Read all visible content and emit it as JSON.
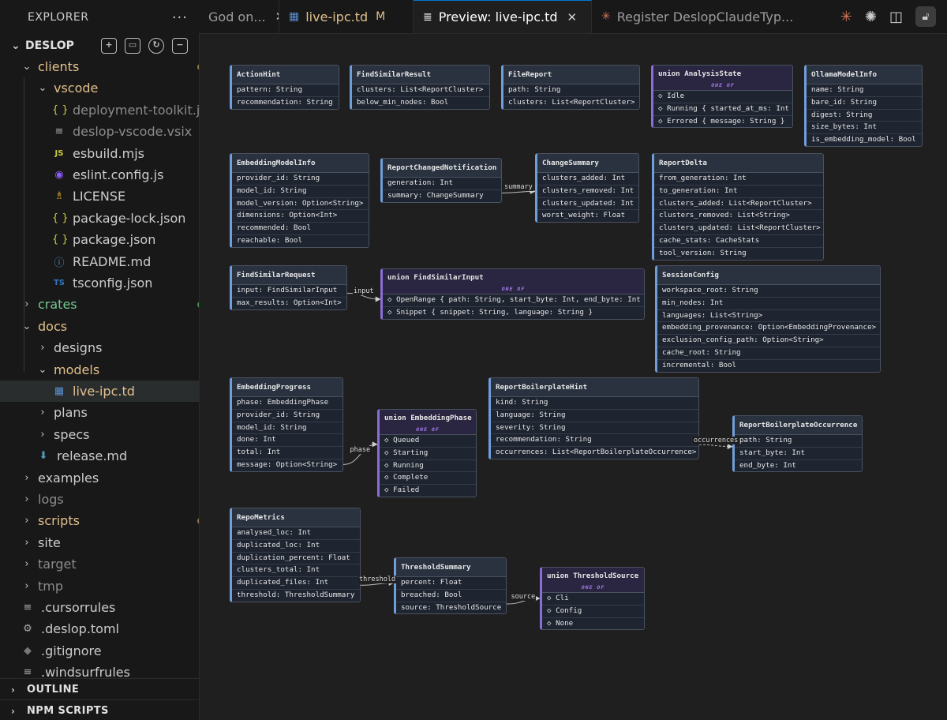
{
  "explorer": {
    "title": "EXPLORER",
    "project": "DESLOP",
    "tree": [
      {
        "label": "clients",
        "kind": "folder",
        "open": true,
        "depth": 0,
        "color": "yellow",
        "status": "dot"
      },
      {
        "label": "vscode",
        "kind": "folder",
        "open": true,
        "depth": 1,
        "color": "yellow",
        "status": "dot"
      },
      {
        "label": "deployment-toolkit.j...",
        "kind": "file",
        "icon": "{ }",
        "depth": 2,
        "color": "gray"
      },
      {
        "label": "deslop-vscode.vsix",
        "kind": "file",
        "icon": "≡",
        "depth": 2,
        "color": "gray"
      },
      {
        "label": "esbuild.mjs",
        "kind": "file",
        "icon": "JS",
        "depth": 2
      },
      {
        "label": "eslint.config.js",
        "kind": "file",
        "icon": "◉",
        "depth": 2
      },
      {
        "label": "LICENSE",
        "kind": "file",
        "icon": "♗",
        "depth": 2,
        "status": "arrow"
      },
      {
        "label": "package-lock.json",
        "kind": "file",
        "icon": "{ }",
        "depth": 2
      },
      {
        "label": "package.json",
        "kind": "file",
        "icon": "{ }",
        "depth": 2
      },
      {
        "label": "README.md",
        "kind": "file",
        "icon": "ⓘ",
        "depth": 2
      },
      {
        "label": "tsconfig.json",
        "kind": "file",
        "icon": "TS",
        "depth": 2
      },
      {
        "label": "crates",
        "kind": "folder",
        "open": false,
        "depth": 0,
        "color": "green",
        "status": "dot-green"
      },
      {
        "label": "docs",
        "kind": "folder",
        "open": true,
        "depth": 0,
        "color": "yellow"
      },
      {
        "label": "designs",
        "kind": "folder",
        "open": false,
        "depth": 1
      },
      {
        "label": "models",
        "kind": "folder",
        "open": true,
        "depth": 1,
        "color": "yellow",
        "status": "dot"
      },
      {
        "label": "live-ipc.td",
        "kind": "file",
        "icon": "▦",
        "depth": 2,
        "color": "yellow",
        "status": "M",
        "selected": true
      },
      {
        "label": "plans",
        "kind": "folder",
        "open": false,
        "depth": 1,
        "status": "dot"
      },
      {
        "label": "specs",
        "kind": "folder",
        "open": false,
        "depth": 1
      },
      {
        "label": "release.md",
        "kind": "file",
        "icon": "⬇",
        "depth": 1
      },
      {
        "label": "examples",
        "kind": "folder",
        "open": false,
        "depth": 0
      },
      {
        "label": "logs",
        "kind": "folder",
        "open": false,
        "depth": 0,
        "color": "gray"
      },
      {
        "label": "scripts",
        "kind": "folder",
        "open": false,
        "depth": 0,
        "color": "yellow",
        "status": "dot"
      },
      {
        "label": "site",
        "kind": "folder",
        "open": false,
        "depth": 0
      },
      {
        "label": "target",
        "kind": "folder",
        "open": false,
        "depth": 0,
        "color": "gray"
      },
      {
        "label": "tmp",
        "kind": "folder",
        "open": false,
        "depth": 0,
        "color": "gray"
      },
      {
        "label": ".cursorrules",
        "kind": "file",
        "icon": "≡",
        "depth": 0
      },
      {
        "label": ".deslop.toml",
        "kind": "file",
        "icon": "⚙",
        "depth": 0
      },
      {
        "label": ".gitignore",
        "kind": "file",
        "icon": "◆",
        "depth": 0
      },
      {
        "label": ".windsurfrules",
        "kind": "file",
        "icon": "≡",
        "depth": 0
      }
    ],
    "outline_label": "OUTLINE",
    "npm_label": "NPM SCRIPTS"
  },
  "tabs": [
    {
      "label": "God on...",
      "close": true
    },
    {
      "label": "live-ipc.td",
      "icon": "▦",
      "modified": "M"
    },
    {
      "label": "Preview: live-ipc.td",
      "icon": "≣",
      "close": true,
      "active": true
    },
    {
      "label": "Register DeslopClaudeTyp...",
      "icon": "✳"
    }
  ],
  "colors": {
    "accent": "#0078d4",
    "struct_accent": "#6f9ed9",
    "union_accent": "#8a6ed6",
    "oneof": "#a57cf0",
    "modified": "#e2c08d"
  },
  "diagram": {
    "oneof_label": "ONE OF",
    "nodes": [
      {
        "id": "ActionHint",
        "title": "ActionHint",
        "fields": [
          "pattern: String",
          "recommendation: String"
        ]
      },
      {
        "id": "FindSimilarResult",
        "title": "FindSimilarResult",
        "fields": [
          "clusters: List<ReportCluster>",
          "below_min_nodes: Bool"
        ]
      },
      {
        "id": "FileReport",
        "title": "FileReport",
        "fields": [
          "path: String",
          "clusters: List<ReportCluster>"
        ]
      },
      {
        "id": "AnalysisState",
        "title": "union AnalysisState",
        "union": true,
        "fields": [
          "◇ Idle",
          "◇ Running { started_at_ms: Int }",
          "◇ Errored { message: String }"
        ]
      },
      {
        "id": "OllamaModelInfo",
        "title": "OllamaModelInfo",
        "fields": [
          "name: String",
          "bare_id: String",
          "digest: String",
          "size_bytes: Int",
          "is_embedding_model: Bool"
        ]
      },
      {
        "id": "EmbeddingModelInfo",
        "title": "EmbeddingModelInfo",
        "fields": [
          "provider_id: String",
          "model_id: String",
          "model_version: Option<String>",
          "dimensions: Option<Int>",
          "recommended: Bool",
          "reachable: Bool"
        ]
      },
      {
        "id": "ReportChangedNotification",
        "title": "ReportChangedNotification",
        "fields": [
          "generation: Int",
          "summary: ChangeSummary"
        ]
      },
      {
        "id": "ChangeSummary",
        "title": "ChangeSummary",
        "fields": [
          "clusters_added: Int",
          "clusters_removed: Int",
          "clusters_updated: Int",
          "worst_weight: Float"
        ]
      },
      {
        "id": "ReportDelta",
        "title": "ReportDelta",
        "fields": [
          "from_generation: Int",
          "to_generation: Int",
          "clusters_added: List<ReportCluster>",
          "clusters_removed: List<String>",
          "clusters_updated: List<ReportCluster>",
          "cache_stats: CacheStats",
          "tool_version: String"
        ]
      },
      {
        "id": "FindSimilarRequest",
        "title": "FindSimilarRequest",
        "fields": [
          "input: FindSimilarInput",
          "max_results: Option<Int>"
        ]
      },
      {
        "id": "FindSimilarInput",
        "title": "union FindSimilarInput",
        "union": true,
        "fields": [
          "◇ OpenRange { path: String, start_byte: Int, end_byte: Int }",
          "◇ Snippet { snippet: String, language: String }"
        ]
      },
      {
        "id": "SessionConfig",
        "title": "SessionConfig",
        "fields": [
          "workspace_root: String",
          "min_nodes: Int",
          "languages: List<String>",
          "embedding_provenance: Option<EmbeddingProvenance>",
          "exclusion_config_path: Option<String>",
          "cache_root: String",
          "incremental: Bool"
        ]
      },
      {
        "id": "EmbeddingProgress",
        "title": "EmbeddingProgress",
        "fields": [
          "phase: EmbeddingPhase",
          "provider_id: String",
          "model_id: String",
          "done: Int",
          "total: Int",
          "message: Option<String>"
        ]
      },
      {
        "id": "EmbeddingPhase",
        "title": "union EmbeddingPhase",
        "union": true,
        "fields": [
          "◇ Queued",
          "◇ Starting",
          "◇ Running",
          "◇ Complete",
          "◇ Failed"
        ]
      },
      {
        "id": "ReportBoilerplateHint",
        "title": "ReportBoilerplateHint",
        "fields": [
          "kind: String",
          "language: String",
          "severity: String",
          "recommendation: String",
          "occurrences: List<ReportBoilerplateOccurrence>"
        ]
      },
      {
        "id": "ReportBoilerplateOccurrence",
        "title": "ReportBoilerplateOccurrence",
        "fields": [
          "path: String",
          "start_byte: Int",
          "end_byte: Int"
        ]
      },
      {
        "id": "RepoMetrics",
        "title": "RepoMetrics",
        "fields": [
          "analysed_loc: Int",
          "duplicated_loc: Int",
          "duplication_percent: Float",
          "clusters_total: Int",
          "duplicated_files: Int",
          "threshold: ThresholdSummary"
        ]
      },
      {
        "id": "ThresholdSummary",
        "title": "ThresholdSummary",
        "fields": [
          "percent: Float",
          "breached: Bool",
          "source: ThresholdSource"
        ]
      },
      {
        "id": "ThresholdSource",
        "title": "union ThresholdSource",
        "union": true,
        "fields": [
          "◇ Cli",
          "◇ Config",
          "◇ None"
        ]
      }
    ],
    "edges": [
      {
        "from": "ReportChangedNotification",
        "to": "ChangeSummary",
        "label": "summary"
      },
      {
        "from": "FindSimilarRequest",
        "to": "FindSimilarInput",
        "label": "input"
      },
      {
        "from": "EmbeddingProgress",
        "to": "EmbeddingPhase",
        "label": "phase"
      },
      {
        "from": "ReportBoilerplateHint",
        "to": "ReportBoilerplateOccurrence",
        "label": "occurrences"
      },
      {
        "from": "RepoMetrics",
        "to": "ThresholdSummary",
        "label": "threshold"
      },
      {
        "from": "ThresholdSummary",
        "to": "ThresholdSource",
        "label": "source"
      }
    ]
  }
}
